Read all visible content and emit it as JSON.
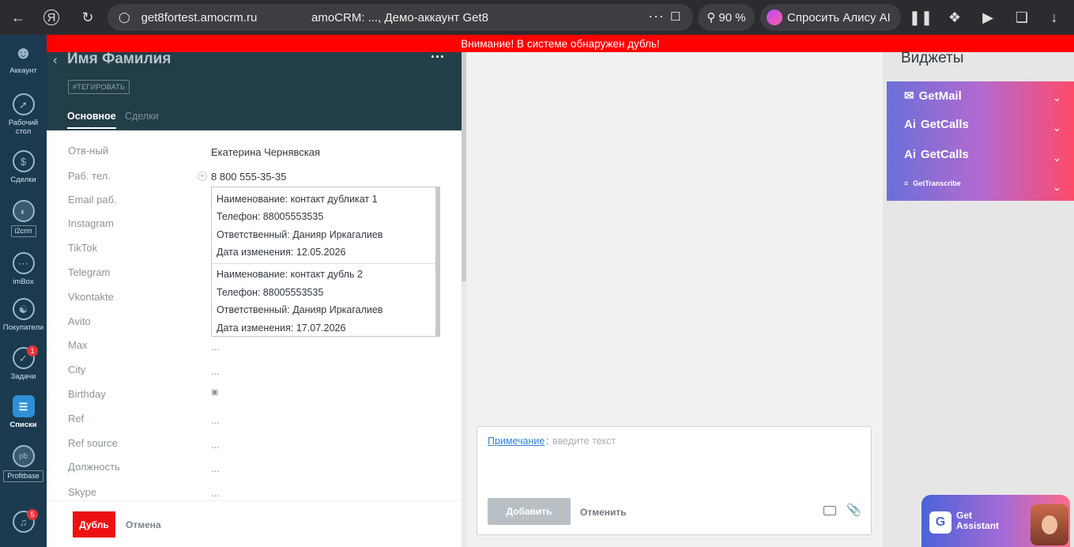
{
  "browser": {
    "host": "get8fortest.amocrm.ru",
    "tab_title": "amoCRM: ..., Демо-аккаунт Get8",
    "more": "···",
    "zoom": "90 %",
    "alice": "Спросить Алису AI"
  },
  "alert": "Внимание! В системе обнаружен дубль!",
  "sidebar": {
    "items": [
      {
        "label": "Аккаунт"
      },
      {
        "label": "Рабочий стол"
      },
      {
        "label": "Сделки"
      },
      {
        "label": "i2crm"
      },
      {
        "label": "imBox"
      },
      {
        "label": "Покупатели"
      },
      {
        "label": "Задачи",
        "badge": "1"
      },
      {
        "label": "Списки"
      },
      {
        "label": "Profitbase"
      },
      {
        "badge": "5"
      }
    ]
  },
  "card": {
    "title": "Имя Фамилия",
    "tag_button": "#ТЕГИРОВАТЬ",
    "tabs": [
      "Основное",
      "Сделки"
    ],
    "fields": [
      {
        "label": "Отв-ный",
        "value": "Екатерина Чернявская"
      },
      {
        "label": "Раб. тел.",
        "value": "8 800 555-35-35"
      },
      {
        "label": "Email раб.",
        "value": ""
      },
      {
        "label": "Instagram",
        "value": ""
      },
      {
        "label": "TikTok",
        "value": ""
      },
      {
        "label": "Telegram",
        "value": ""
      },
      {
        "label": "Vkontakte",
        "value": ""
      },
      {
        "label": "Avito",
        "value": ""
      },
      {
        "label": "Max",
        "value": "..."
      },
      {
        "label": "City",
        "value": "..."
      },
      {
        "label": "Birthday",
        "value": ""
      },
      {
        "label": "Ref",
        "value": "..."
      },
      {
        "label": "Ref source",
        "value": "..."
      },
      {
        "label": "Должность",
        "value": "..."
      },
      {
        "label": "Skype",
        "value": "..."
      }
    ],
    "duplicates": [
      {
        "name": "Наименование: контакт дубликат 1",
        "phone": "Телефон: 88005553535",
        "resp": "Ответственный: Данияр Иркагалиев",
        "date": "Дата изменения: 12.05.2026"
      },
      {
        "name": "Наименование: контакт дубль 2",
        "phone": "Телефон: 88005553535",
        "resp": "Ответственный: Данияр Иркагалиев",
        "date": "Дата изменения: 17.07.2026"
      }
    ],
    "footer": {
      "dubl": "Дубль",
      "cancel": "Отмена"
    }
  },
  "note": {
    "link": "Примечание",
    "colon": ":",
    "placeholder": "введите текст",
    "add": "Добавить",
    "cancel": "Отменить"
  },
  "widgets": {
    "title": "Виджеты",
    "items": [
      "GetMail",
      "GetCalls",
      "GetCalls",
      "GetTranscribe"
    ]
  },
  "assistant": {
    "line1": "Get",
    "line2": "Assistant",
    "logo": "G"
  },
  "colors": {
    "alert": "#ff0000",
    "sidebar": "#1b3a4f",
    "card_header": "#223e48",
    "dubl_button": "#ee1111"
  }
}
